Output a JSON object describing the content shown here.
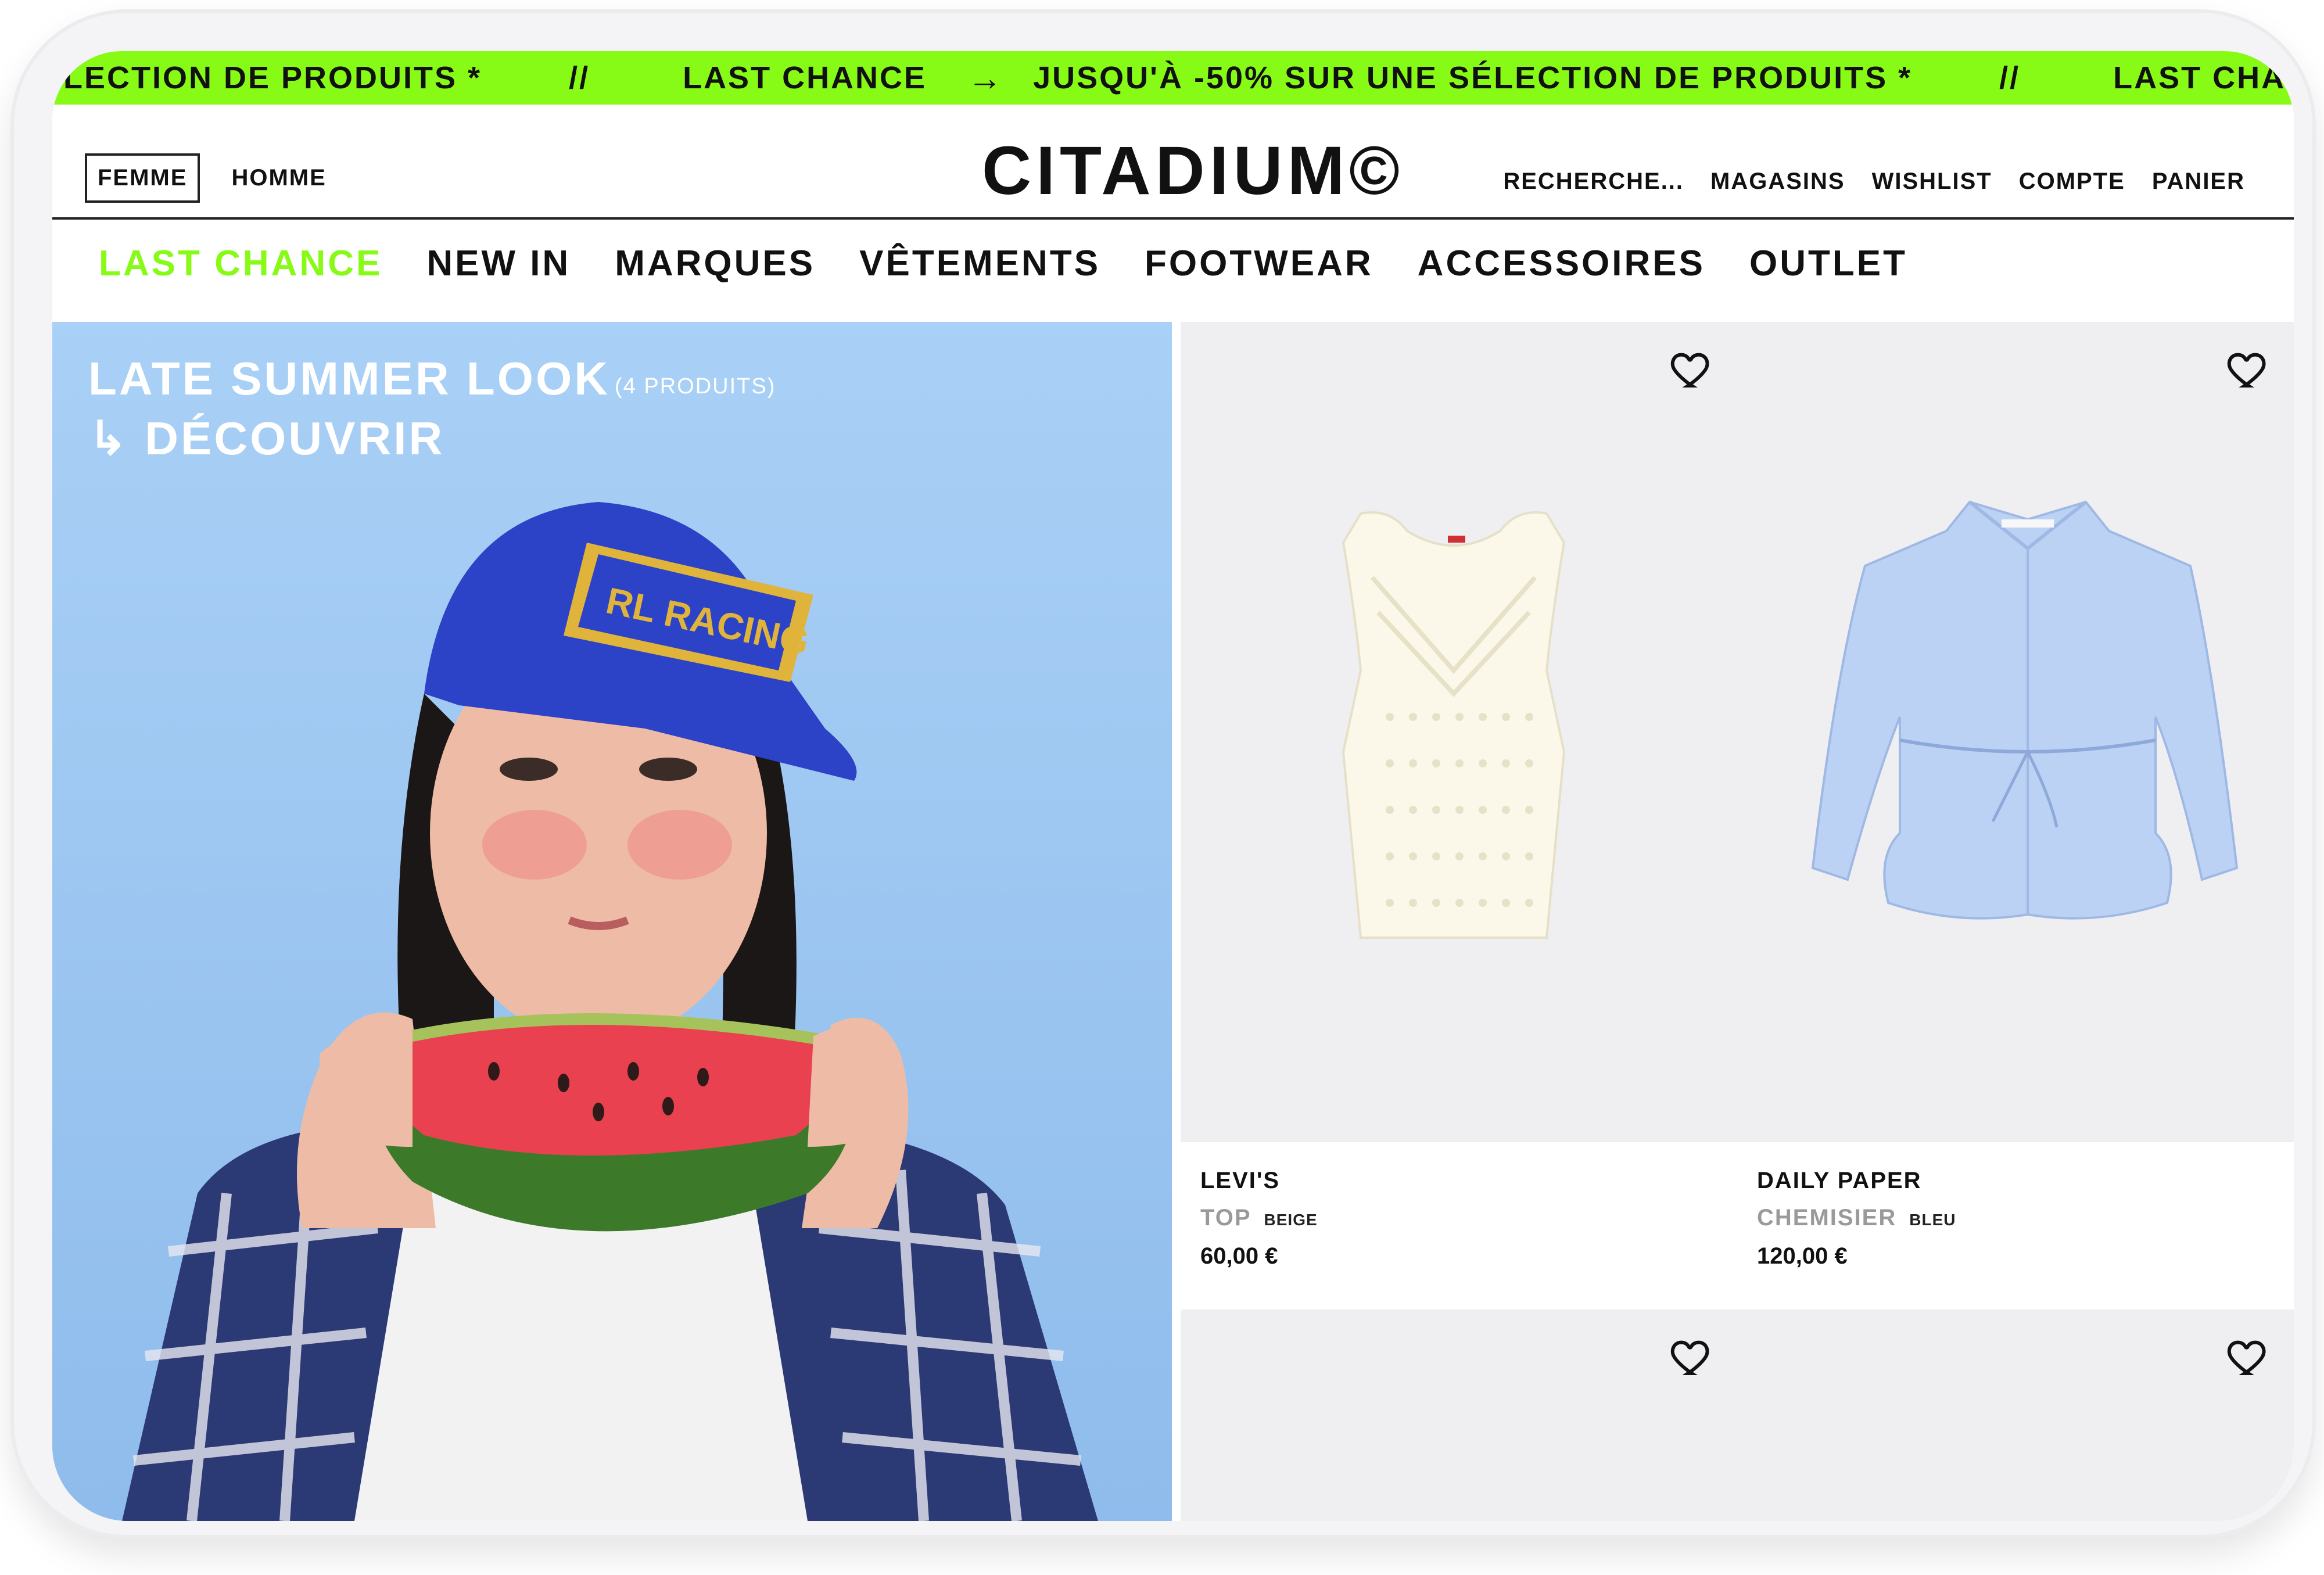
{
  "marquee": {
    "items": [
      "ÉLECTION DE PRODUITS *",
      "//",
      "LAST CHANCE",
      "→",
      "JUSQU'À -50% SUR UNE SÉLECTION DE PRODUITS *",
      "//",
      "LAST CHANCE",
      "⤻"
    ]
  },
  "header": {
    "gender_tabs": [
      "FEMME",
      "HOMME"
    ],
    "logo": "CITADIUM©",
    "utility": [
      "RECHERCHE...",
      "MAGASINS",
      "WISHLIST",
      "COMPTE",
      "PANIER"
    ]
  },
  "categories": [
    "LAST CHANCE",
    "NEW IN",
    "MARQUES",
    "VÊTEMENTS",
    "FOOTWEAR",
    "ACCESSOIRES",
    "OUTLET"
  ],
  "hero": {
    "title": "LATE SUMMER LOOK",
    "count": "(4 PRODUITS)",
    "cta": "↳ DÉCOUVRIR"
  },
  "products": [
    {
      "brand": "LEVI'S",
      "type": "TOP",
      "color": "BEIGE",
      "price": "60,00 €"
    },
    {
      "brand": "DAILY PAPER",
      "type": "CHEMISIER",
      "color": "BLEU",
      "price": "120,00 €"
    }
  ],
  "colors": {
    "accent": "#87fb16",
    "text": "#111111",
    "card_bg": "#efeff1"
  },
  "icons": [
    "heart-icon",
    "arrow-right-icon",
    "menu-arrow-icon",
    "return-arrow-icon"
  ]
}
